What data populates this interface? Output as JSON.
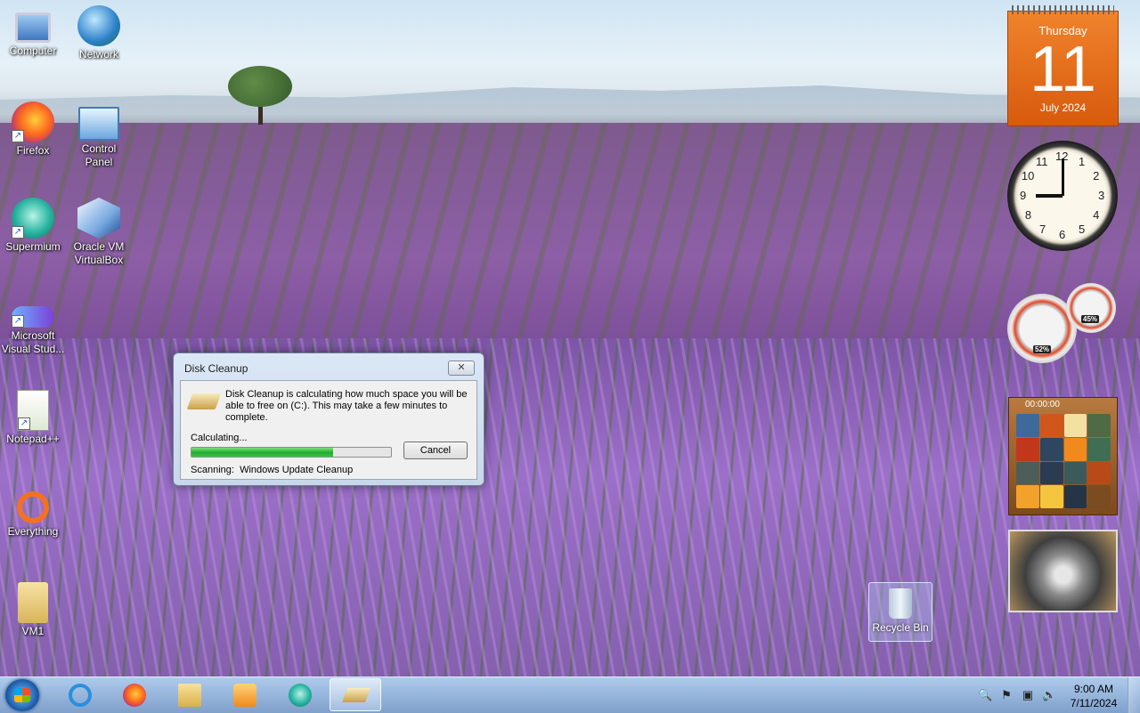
{
  "desktop": {
    "icons": [
      {
        "label": "Computer",
        "icon": "computer-icon"
      },
      {
        "label": "Network",
        "icon": "network-icon"
      },
      {
        "label": "Firefox",
        "icon": "firefox-icon"
      },
      {
        "label": "Control Panel",
        "icon": "control-panel-icon"
      },
      {
        "label": "Supermium",
        "icon": "supermium-icon"
      },
      {
        "label": "Oracle VM VirtualBox",
        "icon": "virtualbox-icon"
      },
      {
        "label": "Microsoft Visual Stud...",
        "icon": "visual-studio-icon"
      },
      {
        "label": "Notepad++",
        "icon": "notepadplusplus-icon"
      },
      {
        "label": "Everything",
        "icon": "everything-icon"
      },
      {
        "label": "VM1",
        "icon": "folder-user-icon"
      }
    ],
    "recycle_bin": {
      "label": "Recycle Bin",
      "icon": "recycle-bin-icon"
    }
  },
  "dialog": {
    "title": "Disk Cleanup",
    "close_glyph": "✕",
    "message": "Disk Cleanup is calculating how much space you will be able to free on  (C:). This may take a few minutes to complete.",
    "status": "Calculating...",
    "progress_fraction": 0.71,
    "cancel_label": "Cancel",
    "scanning_label": "Scanning:",
    "scanning_item": "Windows Update Cleanup"
  },
  "gadgets": {
    "calendar": {
      "weekday": "Thursday",
      "day": "11",
      "month_year": "July 2024"
    },
    "clock": {
      "numbers": [
        "12",
        "1",
        "2",
        "3",
        "4",
        "5",
        "6",
        "7",
        "8",
        "9",
        "10",
        "11"
      ],
      "hour": 9,
      "minute": 0
    },
    "cpu_meter": {
      "cpu": "52%",
      "memory": "45%"
    },
    "puzzle": {
      "timer": "00:00:00"
    },
    "slideshow": {
      "icon": "koala-photo"
    }
  },
  "taskbar": {
    "start_icon": "windows-start-icon",
    "pinned": [
      {
        "icon": "internet-explorer-icon"
      },
      {
        "icon": "firefox-icon"
      },
      {
        "icon": "file-explorer-icon"
      },
      {
        "icon": "media-player-icon"
      },
      {
        "icon": "supermium-icon"
      },
      {
        "icon": "disk-cleanup-icon",
        "active": true
      }
    ],
    "tray": [
      {
        "icon": "search-tray-icon",
        "glyph": "🔍"
      },
      {
        "icon": "action-center-flag-icon",
        "glyph": "⚑"
      },
      {
        "icon": "network-tray-icon",
        "glyph": "▣"
      },
      {
        "icon": "volume-muted-icon",
        "glyph": "🔈"
      }
    ],
    "time": "9:00 AM",
    "date": "7/11/2024"
  },
  "colors": {
    "calendar_orange": "#e8701e",
    "progress_green": "#1fae2e",
    "taskbar_blue": "#8fb0d8"
  }
}
